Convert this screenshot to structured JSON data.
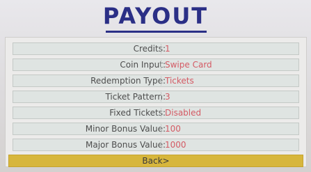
{
  "title": "PAYOUT",
  "settings": [
    {
      "label": "Credits:",
      "value": "1"
    },
    {
      "label": "Coin Input:",
      "value": "Swipe Card"
    },
    {
      "label": "Redemption Type:",
      "value": "Tickets"
    },
    {
      "label": "Ticket Pattern:",
      "value": "3"
    },
    {
      "label": "Fixed Tickets:",
      "value": "Disabled"
    },
    {
      "label": "Minor Bonus Value:",
      "value": "100"
    },
    {
      "label": "Major Bonus Value:",
      "value": "1000"
    }
  ],
  "back_label": "Back>",
  "colors": {
    "title": "#2b2f86",
    "value_text": "#d45a64",
    "back_button": "#d7b63c"
  }
}
